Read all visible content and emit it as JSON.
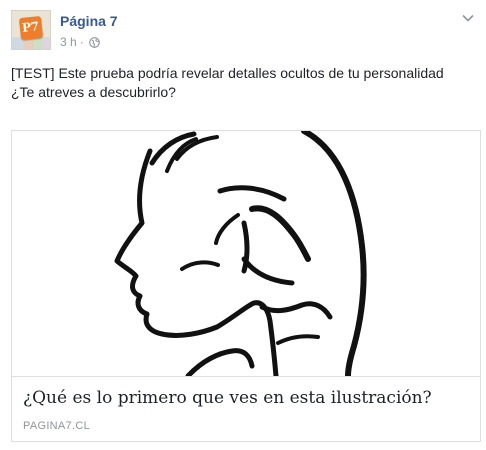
{
  "post": {
    "page_name": "Página 7",
    "avatar_text": "P7",
    "timestamp": "3 h",
    "separator": "·",
    "privacy_icon": "globe-icon",
    "menu_icon": "chevron-down-icon",
    "text_line1": "[TEST] Este prueba podría revelar detalles ocultos de tu personalidad",
    "text_line2": "¿Te atreves a descubrirlo?"
  },
  "link_card": {
    "title": "¿Qué es lo primero que ves en esta ilustración?",
    "domain": "PAGINA7.CL"
  },
  "colors": {
    "page_name": "#365899",
    "meta": "#90949c",
    "avatar_accent": "#f07d2a",
    "border": "#dddfe2"
  }
}
